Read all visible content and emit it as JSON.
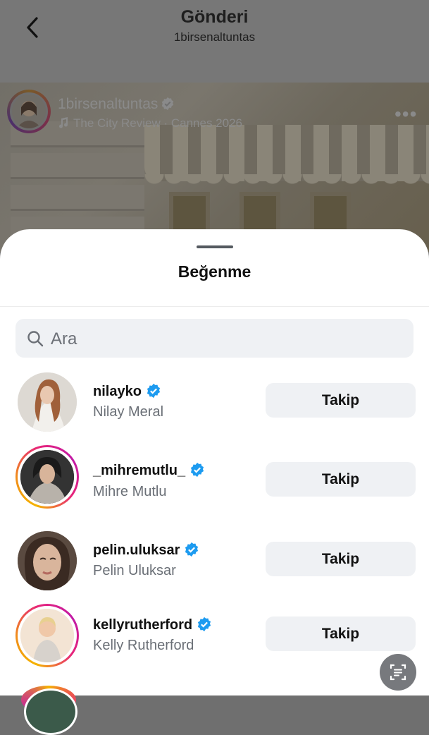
{
  "nav": {
    "title": "Gönderi",
    "subtitle": "1birsenaltuntas"
  },
  "post": {
    "username": "1birsenaltuntas",
    "music": "The City Review · Cannes 2026",
    "more_icon": "more-horizontal-icon"
  },
  "sheet": {
    "title": "Beğenme",
    "search": {
      "placeholder": "Ara",
      "value": ""
    }
  },
  "likers": [
    {
      "username": "nilayko",
      "full_name": "Nilay Meral",
      "button": "Takip",
      "story_ring": false
    },
    {
      "username": "_mihremutlu_",
      "full_name": "Mihre Mutlu",
      "button": "Takip",
      "story_ring": true
    },
    {
      "username": "pelin.uluksar",
      "full_name": "Pelin Uluksar",
      "button": "Takip",
      "story_ring": false
    },
    {
      "username": "kellyrutherford",
      "full_name": "Kelly Rutherford",
      "button": "Takip",
      "story_ring": true
    }
  ],
  "colors": {
    "verified": "#1d9bf0",
    "button_bg": "#eff1f4",
    "secondary_text": "#6a6f76"
  }
}
